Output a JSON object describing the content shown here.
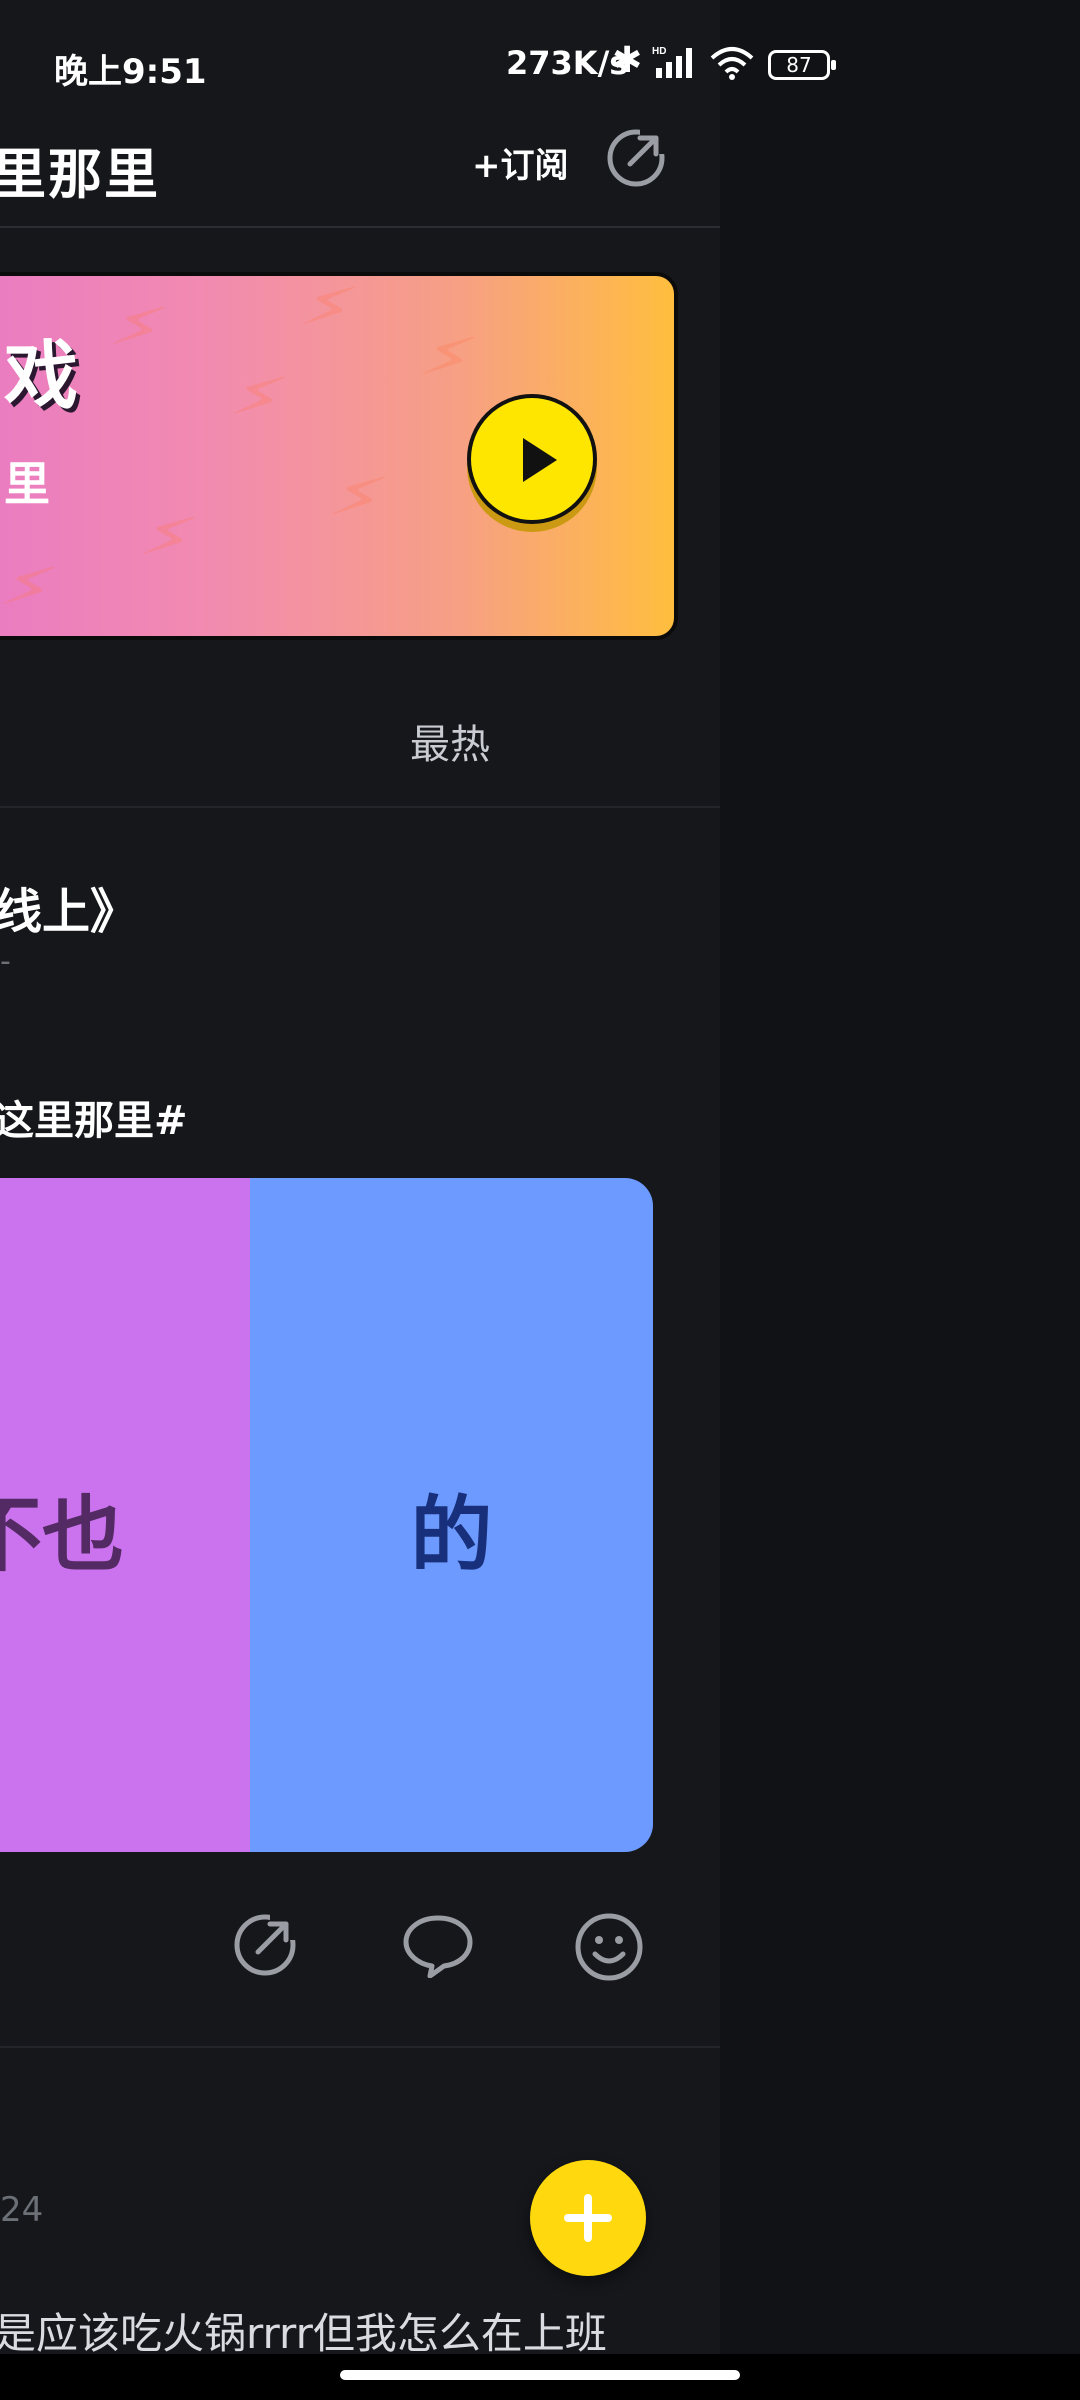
{
  "status_bar": {
    "time": "晚上9:51",
    "network_speed": "273K/s",
    "battery": "87"
  },
  "header": {
    "title": "里那里",
    "subscribe_label": "+订阅",
    "share_icon": "share-icon"
  },
  "banner": {
    "title_fragment": "戏",
    "subtitle_fragment": "里"
  },
  "tabs": {
    "hot_label": "最热"
  },
  "post1": {
    "title": "线上》",
    "meta": "-",
    "tag": "这里那里#",
    "tiles": [
      {
        "text": "不也",
        "color": "#cb73ee"
      },
      {
        "text": "的",
        "color": "#6d9aff"
      }
    ]
  },
  "post2": {
    "time": "24",
    "text": "是应该吃火锅rrrr但我怎么在上班"
  }
}
